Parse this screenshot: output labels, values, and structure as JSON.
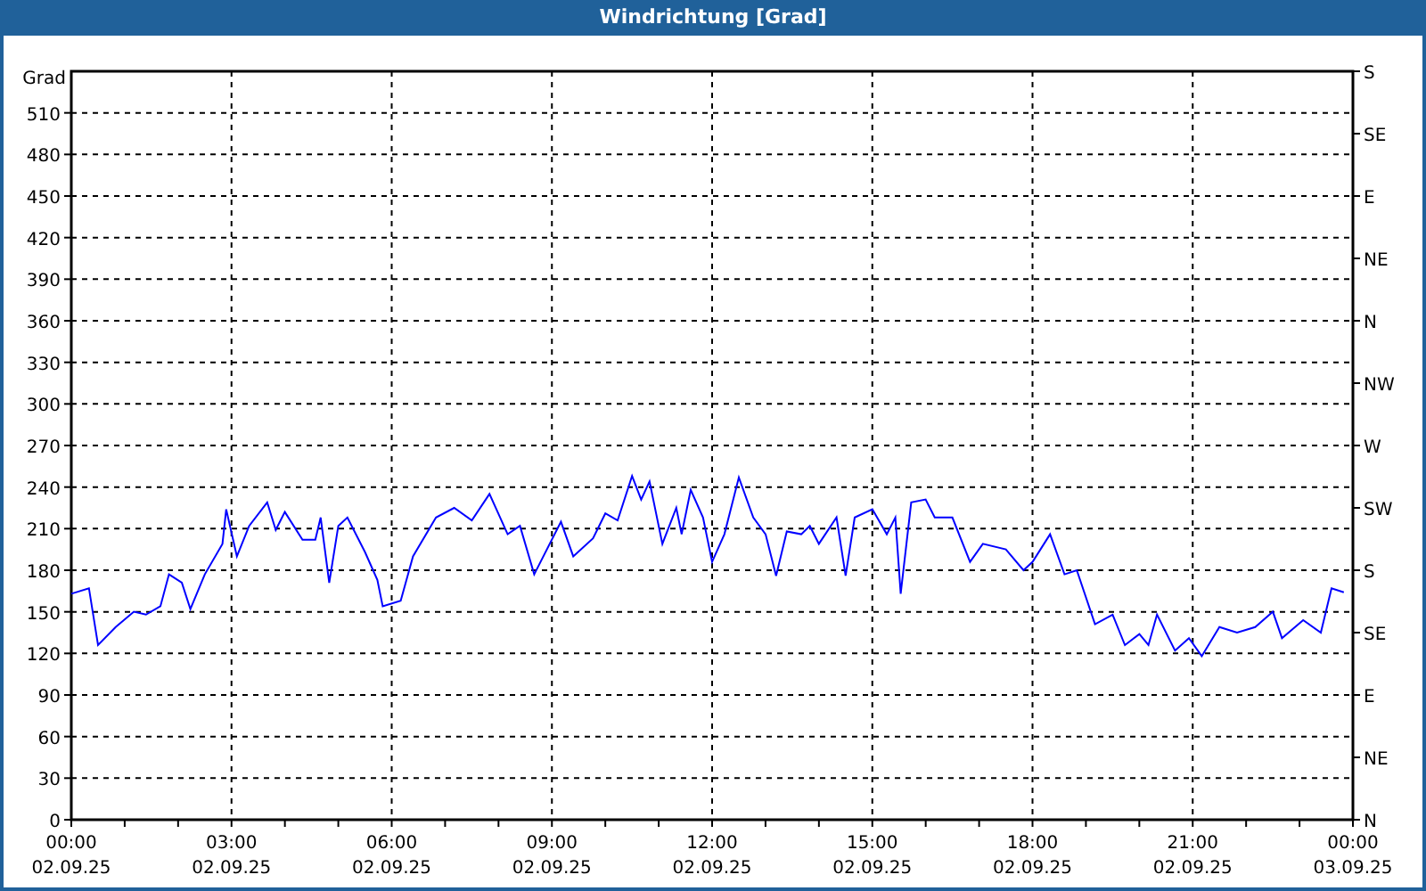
{
  "window": {
    "title": "Windrichtung [Grad]"
  },
  "chart": {
    "chart_data": {
      "type": "line",
      "grid": true,
      "ylabel": "Grad",
      "xlim": [
        0,
        24
      ],
      "ylim": [
        0,
        540
      ],
      "yticks": [
        0,
        30,
        60,
        90,
        120,
        150,
        180,
        210,
        240,
        270,
        300,
        330,
        360,
        390,
        420,
        450,
        480,
        510
      ],
      "xticks": [
        {
          "value": 0,
          "label": "00:00"
        },
        {
          "value": 3,
          "label": "03:00"
        },
        {
          "value": 6,
          "label": "06:00"
        },
        {
          "value": 9,
          "label": "09:00"
        },
        {
          "value": 12,
          "label": "12:00"
        },
        {
          "value": 15,
          "label": "15:00"
        },
        {
          "value": 18,
          "label": "18:00"
        },
        {
          "value": 21,
          "label": "21:00"
        },
        {
          "value": 24,
          "label": "00:00"
        }
      ],
      "x": [
        0,
        0.33,
        0.5,
        0.83,
        1.17,
        1.4,
        1.67,
        1.83,
        2.07,
        2.23,
        2.5,
        2.83,
        2.9,
        3.1,
        3.33,
        3.67,
        3.83,
        4,
        4.33,
        4.57,
        4.67,
        4.83,
        5,
        5.17,
        5.5,
        5.73,
        5.83,
        6.17,
        6.4,
        6.83,
        7.17,
        7.5,
        7.83,
        8.17,
        8.4,
        8.67,
        9.17,
        9.4,
        9.77,
        10,
        10.23,
        10.5,
        10.67,
        10.83,
        11.07,
        11.33,
        11.43,
        11.6,
        11.83,
        12,
        12.23,
        12.5,
        12.77,
        13,
        13.2,
        13.4,
        13.67,
        13.83,
        14,
        14.33,
        14.5,
        14.67,
        15,
        15.27,
        15.43,
        15.53,
        15.73,
        16,
        16.17,
        16.5,
        16.83,
        17.07,
        17.5,
        17.83,
        18,
        18.33,
        18.6,
        18.83,
        19.17,
        19.5,
        19.73,
        20,
        20.17,
        20.33,
        20.67,
        20.93,
        21.17,
        21.5,
        21.83,
        22.17,
        22.5,
        22.67,
        23.07,
        23.4,
        23.6,
        23.83
      ],
      "series": [
        {
          "color": "#0000ff",
          "values": [
            163,
            167,
            126,
            139,
            150,
            148,
            154,
            177,
            171,
            152,
            177,
            199,
            224,
            190,
            212,
            229,
            209,
            222,
            202,
            202,
            218,
            171,
            212,
            218,
            193,
            173,
            154,
            158,
            190,
            218,
            225,
            216,
            235,
            206,
            212,
            177,
            215,
            190,
            203,
            221,
            216,
            248,
            231,
            244,
            199,
            225,
            206,
            238,
            218,
            186,
            206,
            247,
            218,
            206,
            176,
            208,
            206,
            212,
            199,
            218,
            176,
            218,
            224,
            206,
            218,
            163,
            229,
            231,
            218,
            218,
            186,
            199,
            195,
            180,
            186,
            206,
            177,
            180,
            141,
            148,
            126,
            134,
            126,
            148,
            122,
            131,
            118,
            139,
            135,
            139,
            150,
            131,
            144,
            135,
            167,
            164
          ]
        }
      ]
    },
    "x_axis_dates": [
      "02.09.25",
      "02.09.25",
      "02.09.25",
      "02.09.25",
      "02.09.25",
      "02.09.25",
      "02.09.25",
      "02.09.25",
      "03.09.25"
    ],
    "right_axis_labels": [
      "S",
      "SE",
      "E",
      "NE",
      "N",
      "NW",
      "W",
      "SW",
      "S",
      "SE",
      "E",
      "NE",
      "N"
    ]
  }
}
